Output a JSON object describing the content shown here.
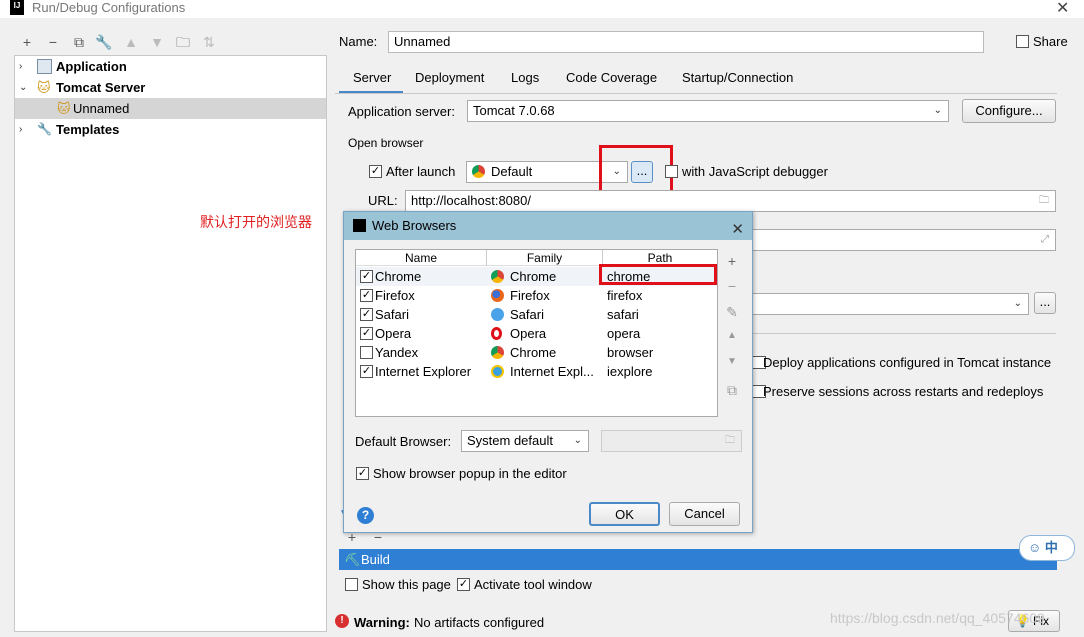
{
  "window": {
    "title": "Run/Debug Configurations",
    "logo": "IJ"
  },
  "tree": {
    "items": [
      {
        "label": "Application"
      },
      {
        "label": "Tomcat Server"
      },
      {
        "label": "Unnamed"
      },
      {
        "label": "Templates"
      }
    ]
  },
  "annotation": "默认打开的浏览器",
  "config": {
    "name_label": "Name:",
    "name_value": "Unnamed",
    "share_label": "Share",
    "tabs": [
      "Server",
      "Deployment",
      "Logs",
      "Code Coverage",
      "Startup/Connection"
    ],
    "app_server_label": "Application server:",
    "app_server_value": "Tomcat 7.0.68",
    "configure_label": "Configure...",
    "open_browser_label": "Open browser",
    "after_launch_label": "After launch",
    "browser_value": "Default",
    "ellipsis_label": "...",
    "js_debugger_label": "with JavaScript debugger",
    "url_label": "URL:",
    "url_value": "http://localhost:8080/",
    "deploy_label": "Deploy applications configured in Tomcat instance",
    "preserve_label": "Preserve sessions across restarts and redeploys",
    "build_label": "Build",
    "show_page_label": "Show this page",
    "activate_label": "Activate tool window",
    "warning_bold": "Warning:",
    "warning_text": "No artifacts configured",
    "fix_label": "Fix"
  },
  "dialog": {
    "title": "Web Browsers",
    "columns": [
      "Name",
      "Family",
      "Path"
    ],
    "rows": [
      {
        "checked": true,
        "name": "Chrome",
        "family": "Chrome",
        "path": "chrome",
        "icon": "chrome-icon"
      },
      {
        "checked": true,
        "name": "Firefox",
        "family": "Firefox",
        "path": "firefox",
        "icon": "firefox-icon"
      },
      {
        "checked": true,
        "name": "Safari",
        "family": "Safari",
        "path": "safari",
        "icon": "safari-icon"
      },
      {
        "checked": true,
        "name": "Opera",
        "family": "Opera",
        "path": "opera",
        "icon": "opera-icon"
      },
      {
        "checked": false,
        "name": "Yandex",
        "family": "Chrome",
        "path": "browser",
        "icon": "chrome-icon"
      },
      {
        "checked": true,
        "name": "Internet Explorer",
        "family": "Internet Expl...",
        "path": "iexplore",
        "icon": "ie-icon"
      }
    ],
    "default_browser_label": "Default Browser:",
    "default_browser_value": "System default",
    "show_popup_label": "Show browser popup in the editor",
    "ok_label": "OK",
    "cancel_label": "Cancel"
  },
  "watermark": "https://blog.csdn.net/qq_40574609",
  "ime": "中",
  "colors": {
    "accent": "#2f7fd4",
    "highlight": "#e0101a",
    "dialog_title": "#9bc3d6"
  }
}
